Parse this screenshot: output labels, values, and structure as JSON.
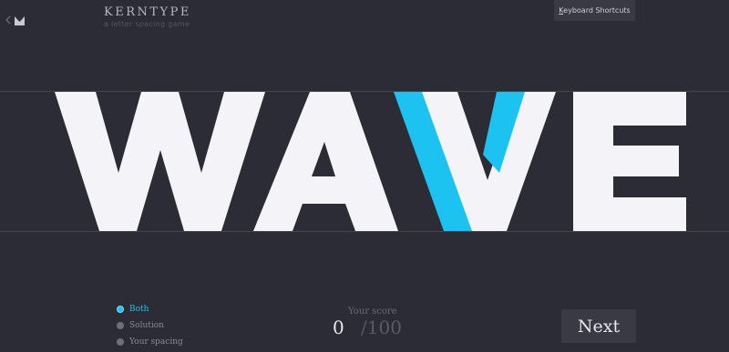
{
  "header": {
    "title": "KERNTYPE",
    "subtitle": "a letter spacing game",
    "shortcuts_key": "K",
    "shortcuts_rest": "eyboard Shortcuts"
  },
  "game": {
    "word": "WAVE",
    "highlight_letter": "V",
    "letter_color": "#f4f4f8",
    "highlight_color": "#1dc3f0",
    "background_color": "#2c2c36"
  },
  "view_options": [
    {
      "label": "Both",
      "selected": true
    },
    {
      "label": "Solution",
      "selected": false
    },
    {
      "label": "Your spacing",
      "selected": false
    }
  ],
  "score": {
    "label": "Your score",
    "value": "0",
    "total": "/100"
  },
  "next_button": {
    "label": "Next"
  }
}
